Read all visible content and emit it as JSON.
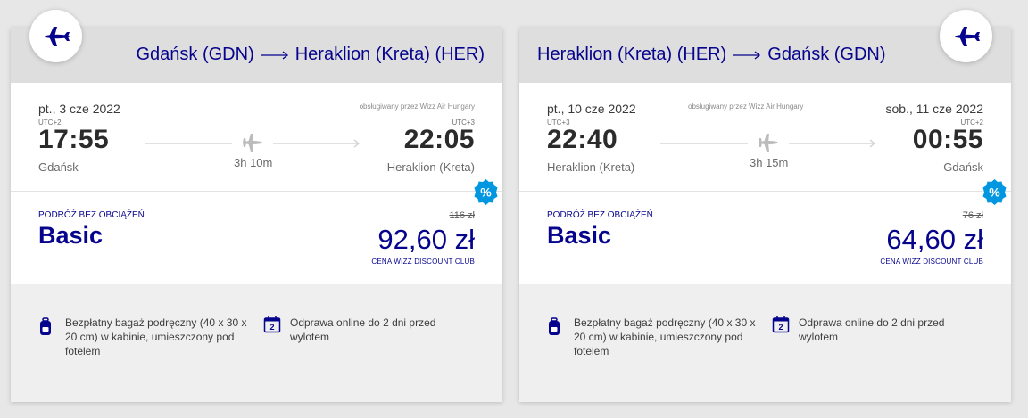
{
  "brand_color": "#06038d",
  "discount_color": "#0096e0",
  "cards": [
    {
      "from": "Gdańsk (GDN)",
      "to": "Heraklion (Kreta) (HER)",
      "departure_date": "pt., 3 cze 2022",
      "arrival_date": "",
      "operator": "obsługiwany przez Wizz Air Hungary",
      "dep_tz": "UTC+2",
      "arr_tz": "UTC+3",
      "dep_time": "17:55",
      "arr_time": "22:05",
      "dep_city": "Gdańsk",
      "arr_city": "Heraklion (Kreta)",
      "duration": "3h 10m",
      "fare_label": "PODRÓŻ BEZ OBCIĄŻEŃ",
      "fare_name": "Basic",
      "old_price": "116 zł",
      "price": "92,60 zł",
      "club_label": "CENA WIZZ DISCOUNT CLUB",
      "discount_symbol": "%",
      "feature_bag": "Bezpłatny bagaż podręczny (40 x 30 x 20 cm) w kabinie, umieszczony pod fotelem",
      "feature_checkin": "Odprawa online do 2 dni przed wylotem",
      "calendar_number": "2"
    },
    {
      "from": "Heraklion (Kreta) (HER)",
      "to": "Gdańsk (GDN)",
      "departure_date": "pt., 10 cze 2022",
      "arrival_date": "sob., 11 cze 2022",
      "operator": "obsługiwany przez Wizz Air Hungary",
      "dep_tz": "UTC+3",
      "arr_tz": "UTC+2",
      "dep_time": "22:40",
      "arr_time": "00:55",
      "dep_city": "Heraklion (Kreta)",
      "arr_city": "Gdańsk",
      "duration": "3h 15m",
      "fare_label": "PODRÓŻ BEZ OBCIĄŻEŃ",
      "fare_name": "Basic",
      "old_price": "76 zł",
      "price": "64,60 zł",
      "club_label": "CENA WIZZ DISCOUNT CLUB",
      "discount_symbol": "%",
      "feature_bag": "Bezpłatny bagaż podręczny (40 x 30 x 20 cm) w kabinie, umieszczony pod fotelem",
      "feature_checkin": "Odprawa online do 2 dni przed wylotem",
      "calendar_number": "2"
    }
  ]
}
